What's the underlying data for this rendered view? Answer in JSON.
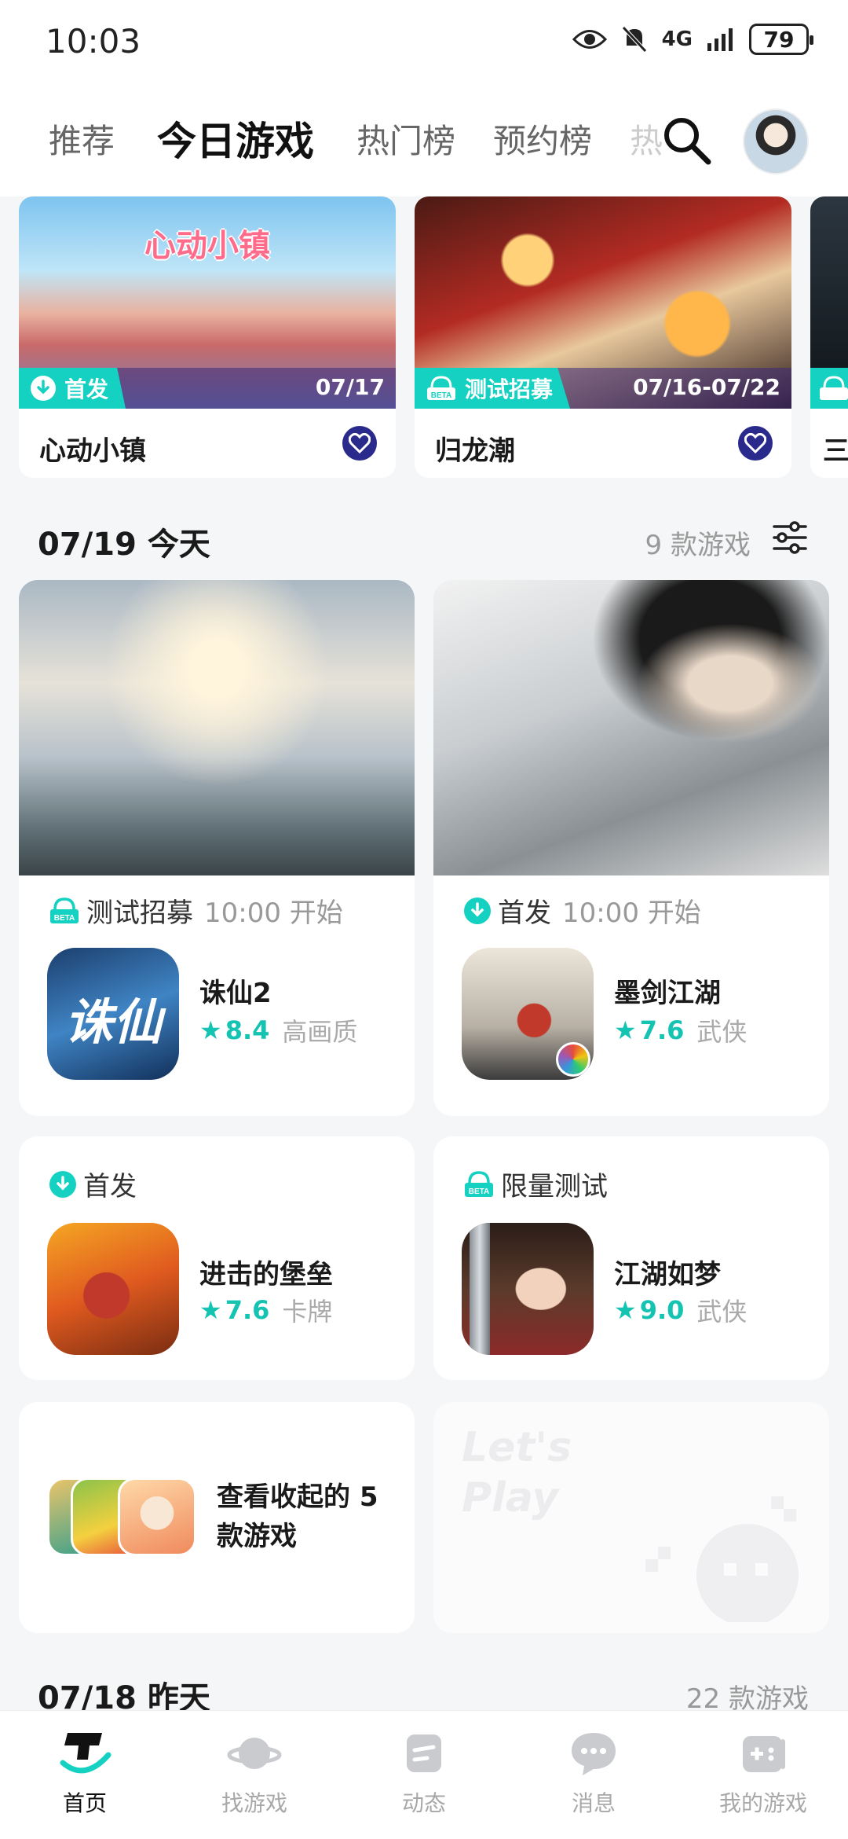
{
  "status_bar": {
    "time": "10:03",
    "network": "4G",
    "battery": "79"
  },
  "tabs": [
    "推荐",
    "今日游戏",
    "热门榜",
    "预约榜",
    "热"
  ],
  "featured": [
    {
      "logo": "心动小镇",
      "badge": "首发",
      "date": "07/17",
      "name": "心动小镇"
    },
    {
      "badge": "测试招募",
      "date": "07/16-07/22",
      "name": "归龙潮"
    },
    {
      "badge": "",
      "name": "三"
    }
  ],
  "today": {
    "heading": "07/19 今天",
    "count": "9 款游戏",
    "cards": [
      {
        "type": "测试招募",
        "time": "10:00 开始",
        "title": "诛仙2",
        "score": "8.4",
        "genre": "高画质",
        "icon_text": "诛仙"
      },
      {
        "type": "首发",
        "time": "10:00 开始",
        "title": "墨剑江湖",
        "score": "7.6",
        "genre": "武侠"
      }
    ],
    "small_cards": [
      {
        "type": "首发",
        "title": "进击的堡垒",
        "score": "7.6",
        "genre": "卡牌"
      },
      {
        "type": "限量测试",
        "title": "江湖如梦",
        "score": "9.0",
        "genre": "武侠"
      }
    ],
    "collapsed": {
      "text": "查看收起的 5 款游戏"
    },
    "watermark": "Let's Play"
  },
  "yesterday": {
    "heading": "07/18 昨天",
    "count": "22 款游戏"
  },
  "bottom_nav": [
    {
      "label": "首页",
      "icon": "home-icon"
    },
    {
      "label": "找游戏",
      "icon": "planet-icon"
    },
    {
      "label": "动态",
      "icon": "feed-icon"
    },
    {
      "label": "消息",
      "icon": "message-icon"
    },
    {
      "label": "我的游戏",
      "icon": "gamepad-icon"
    }
  ],
  "colors": {
    "accent": "#15d1c1",
    "heart": "#2a2a8c"
  }
}
